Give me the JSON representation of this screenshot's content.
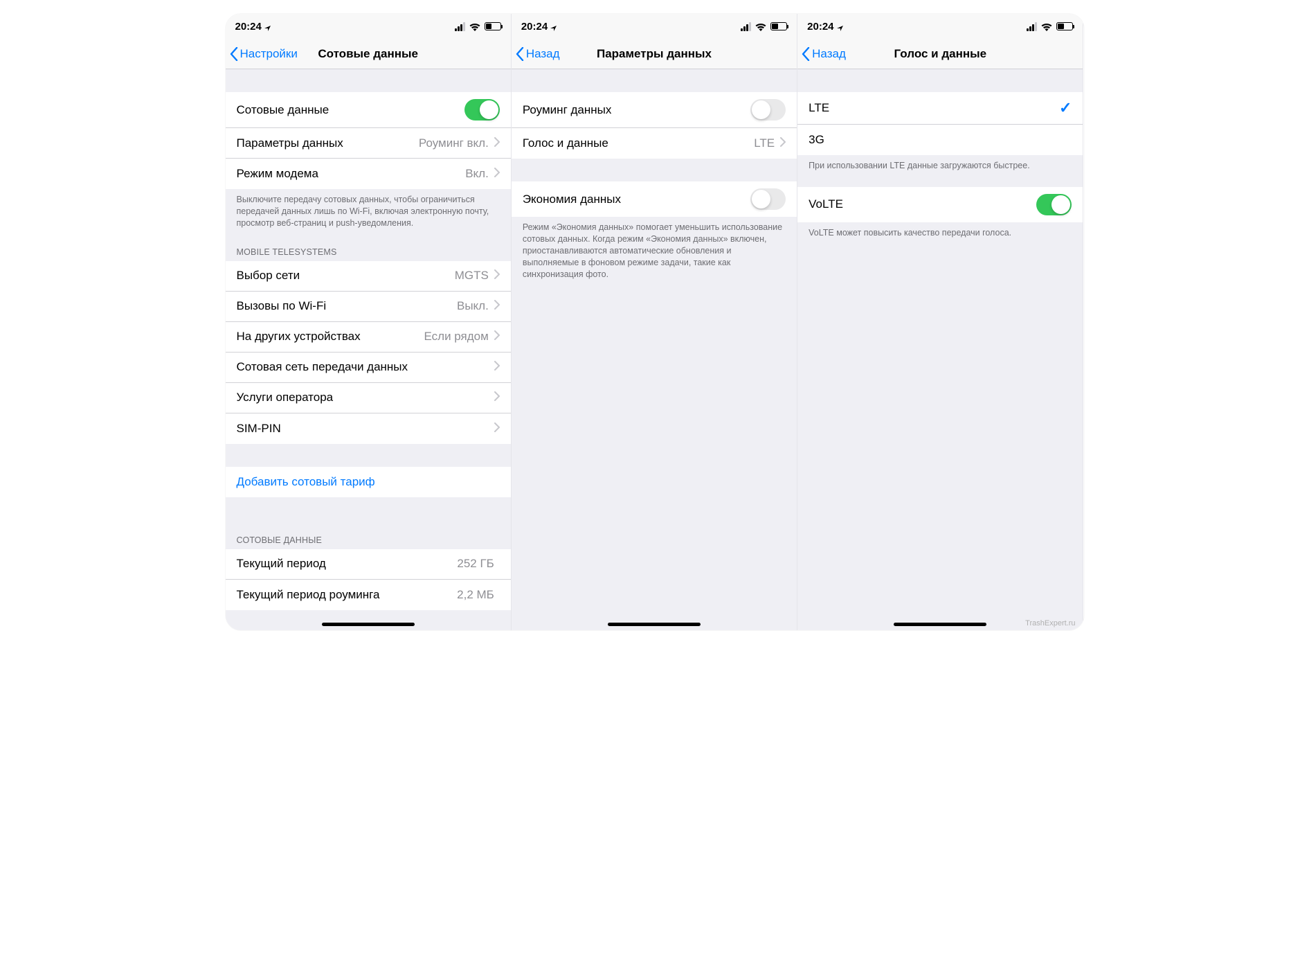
{
  "status": {
    "time": "20:24"
  },
  "phone1": {
    "back": "Настройки",
    "title": "Сотовые данные",
    "rows": {
      "cellular_data": "Сотовые данные",
      "data_options": "Параметры данных",
      "data_options_detail": "Роуминг вкл.",
      "hotspot": "Режим модема",
      "hotspot_detail": "Вкл."
    },
    "footer1": "Выключите передачу сотовых данных, чтобы ограничиться передачей данных лишь по Wi-Fi, включая электронную почту, просмотр веб-страниц и push-уведомления.",
    "header2": "MOBILE TELESYSTEMS",
    "rows2": {
      "network": "Выбор сети",
      "network_detail": "MGTS",
      "wifi_call": "Вызовы по Wi-Fi",
      "wifi_call_detail": "Выкл.",
      "other_devices": "На других устройствах",
      "other_devices_detail": "Если рядом",
      "cellular_net": "Сотовая сеть передачи данных",
      "carrier_services": "Услуги оператора",
      "sim_pin": "SIM-PIN"
    },
    "add_plan": "Добавить сотовый тариф",
    "header3": "СОТОВЫЕ ДАННЫЕ",
    "rows3": {
      "period": "Текущий период",
      "period_val": "252 ГБ",
      "roam_period": "Текущий период роуминга",
      "roam_period_val": "2,2 МБ"
    }
  },
  "phone2": {
    "back": "Назад",
    "title": "Параметры данных",
    "rows": {
      "roaming": "Роуминг данных",
      "voice_data": "Голос и данные",
      "voice_data_detail": "LTE",
      "low_data": "Экономия данных"
    },
    "footer1": "Режим «Экономия данных» помогает уменьшить использование сотовых данных. Когда режим «Экономия данных» включен, приостанавливаются автоматические обновления и выполняемые в фоновом режиме задачи, такие как синхронизация фото."
  },
  "phone3": {
    "back": "Назад",
    "title": "Голос и данные",
    "rows": {
      "lte": "LTE",
      "g3": "3G",
      "volte": "VoLTE"
    },
    "footer1": "При использовании LTE данные загружаются быстрее.",
    "footer2": "VoLTE может повысить качество передачи голоса."
  },
  "watermark": "TrashExpert.ru"
}
